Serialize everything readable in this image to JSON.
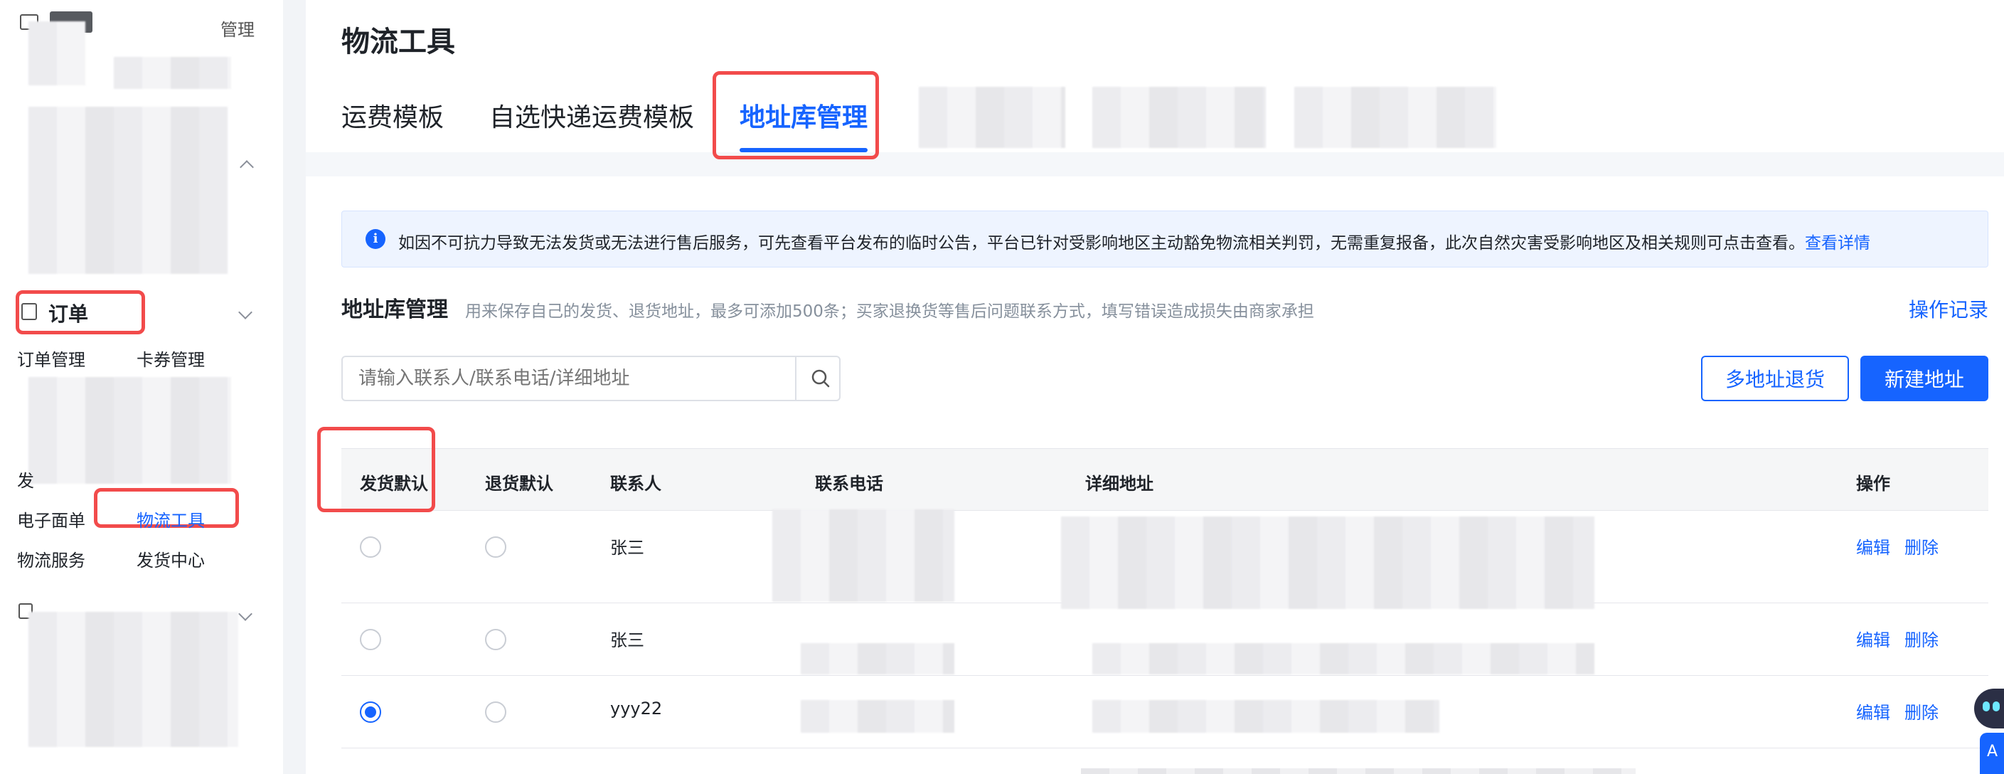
{
  "sidebar": {
    "order_group_title": "订单",
    "top_right_label": "管理",
    "items": {
      "order_manage": "订单管理",
      "coupon_manage": "卡券管理",
      "e_waybill": "电子面单",
      "logistics_tool": "物流工具",
      "logistics_service": "物流服务",
      "delivery_center": "发货中心",
      "partial_fa": "发"
    }
  },
  "page": {
    "title": "物流工具",
    "tabs": [
      "运费模板",
      "自选快递运费模板",
      "地址库管理"
    ],
    "active_tab_index": 2
  },
  "notice": {
    "text": "如因不可抗力导致无法发货或无法进行售后服务，可先查看平台发布的临时公告，平台已针对受影响地区主动豁免物流相关判罚，无需重复报备，此次自然灾害受影响地区及相关规则可点击查看。",
    "link": "查看详情"
  },
  "section": {
    "title": "地址库管理",
    "desc": "用来保存自己的发货、退货地址，最多可添加500条；买家退换货等售后问题联系方式，填写错误造成损失由商家承担",
    "record_link": "操作记录"
  },
  "search": {
    "placeholder": "请输入联系人/联系电话/详细地址"
  },
  "buttons": {
    "multi_return": "多地址退货",
    "new_address": "新建地址"
  },
  "table": {
    "headers": [
      "发货默认",
      "退货默认",
      "联系人",
      "联系电话",
      "详细地址",
      "操作"
    ],
    "rows": [
      {
        "contact": "张三",
        "ship_default": false,
        "return_default": false,
        "edit": "编辑",
        "delete": "删除"
      },
      {
        "contact": "张三",
        "ship_default": false,
        "return_default": false,
        "edit": "编辑",
        "delete": "删除"
      },
      {
        "contact": "yyy22",
        "ship_default": true,
        "return_default": false,
        "edit": "编辑",
        "delete": "删除"
      }
    ]
  },
  "colors": {
    "accent": "#1664ff",
    "highlight_box": "#f24b4b",
    "notice_bg": "#eef4ff"
  }
}
